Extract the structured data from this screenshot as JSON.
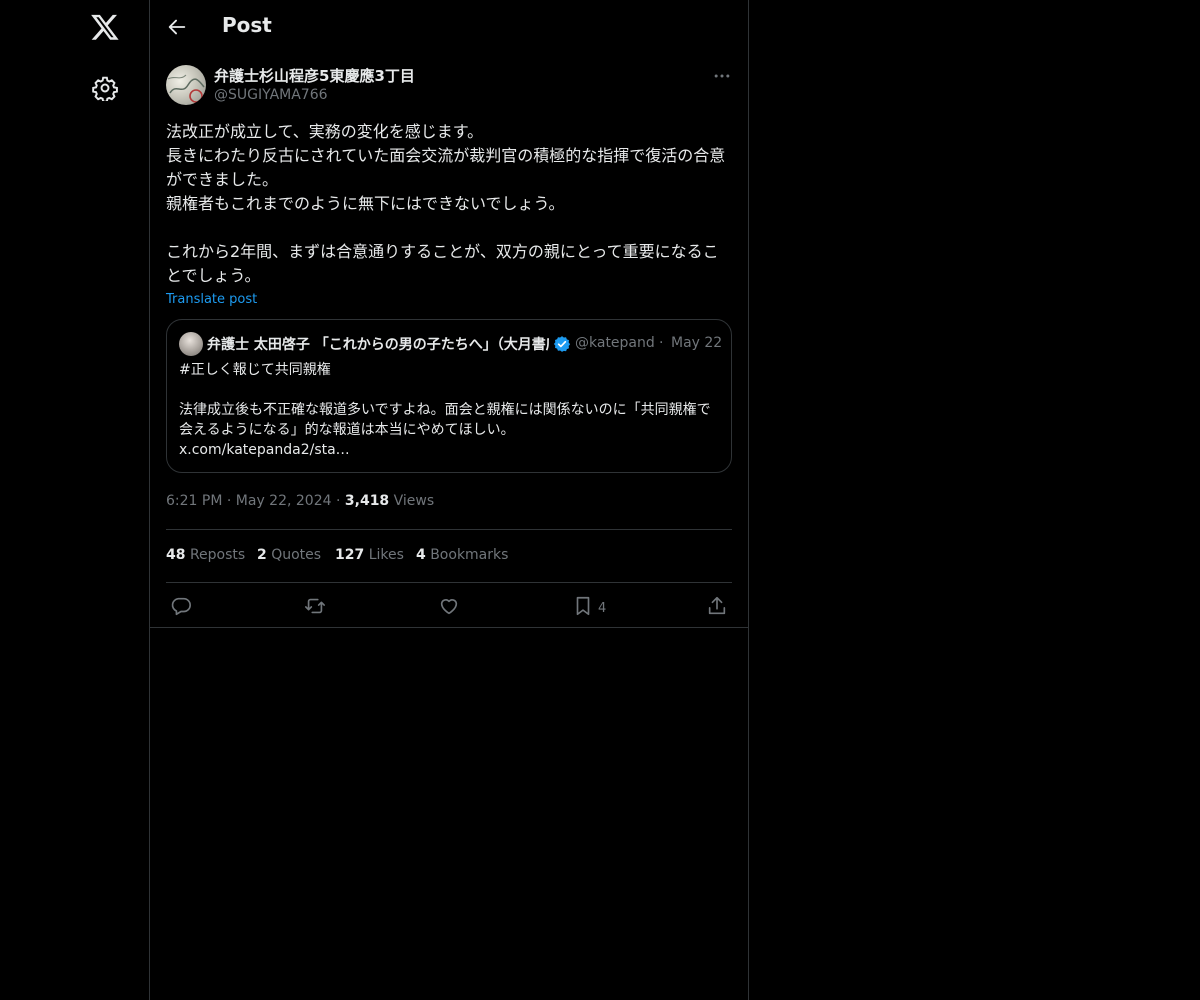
{
  "app": {
    "logo_icon": "x-logo-icon",
    "settings_icon": "gear-icon"
  },
  "header": {
    "title": "Post",
    "back_icon": "arrow-left-icon"
  },
  "post": {
    "author_name": "弁護士杉山程彦5東慶應3丁目",
    "author_handle": "@SUGIYAMA766",
    "text": "法改正が成立して、実務の変化を感じます。\n長きにわたり反古にされていた面会交流が裁判官の積極的な指揮で復活の合意ができました。\n親権者もこれまでのように無下にはできないでしょう。\n\nこれから2年間、まずは合意通りすることが、双方の親にとって重要になることでしょう。",
    "translate_label": "Translate post",
    "more_icon": "more-horizontal-icon"
  },
  "quote": {
    "author_name": "弁護士 太田啓子 「これからの男の子たちへ」（大月書店）",
    "verified_icon": "verified-badge-icon",
    "author_handle": "@katepand",
    "separator": "·",
    "date": "May 22",
    "text": "#正しく報じて共同親権\n\n法律成立後も不正確な報道多いですよね。面会と親権には関係ないのに「共同親権で会えるようになる」的な報道は本当にやめてほしい。\nx.com/katepanda2/sta…"
  },
  "meta": {
    "time": "6:21 PM",
    "separator": "·",
    "date": "May 22, 2024",
    "views_count": "3,418",
    "views_label": "Views"
  },
  "stats": {
    "reposts_count": "48",
    "reposts_label": "Reposts",
    "quotes_count": "2",
    "quotes_label": "Quotes",
    "likes_count": "127",
    "likes_label": "Likes",
    "bookmarks_count": "4",
    "bookmarks_label": "Bookmarks"
  },
  "actions": {
    "reply_icon": "reply-icon",
    "repost_icon": "repost-icon",
    "like_icon": "heart-icon",
    "bookmark_icon": "bookmark-icon",
    "bookmark_count": "4",
    "share_icon": "share-icon"
  },
  "colors": {
    "background": "#000000",
    "text": "#e7e9ea",
    "muted": "#71767b",
    "accent": "#1d9bf0",
    "border": "#2f3336"
  }
}
